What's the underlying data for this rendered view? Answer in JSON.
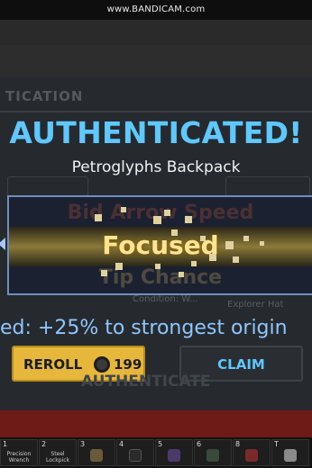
{
  "watermark": "www.BANDICAM.com",
  "background": {
    "ghost_title": "TICATION",
    "ghost_item_label": "Explorer Hat",
    "ghost_condition_label": "Condition: W...",
    "ghost_button": "AUTHENTICATE"
  },
  "popup": {
    "title": "AUTHENTICATED!",
    "item_name": "Petroglyphs Backpack",
    "options": {
      "previous": "Bid Arrow Speed",
      "selected": "Focused",
      "next": "Tip Chance"
    },
    "result_text": "ed: +25% to strongest origin",
    "reroll_label": "REROLL",
    "reroll_cost": "199",
    "claim_label": "CLAIM",
    "colors": {
      "title": "#5ec8ff",
      "selected": "#ffe493",
      "reroll_button": "#e6b73a",
      "claim_text": "#5ec8ff",
      "frame": "#6d8fbf"
    }
  },
  "hotbar": {
    "slots": [
      {
        "number": "1",
        "label": "Precision Wrench"
      },
      {
        "number": "2",
        "label": "Steel Lockpick"
      },
      {
        "number": "3",
        "label": ""
      },
      {
        "number": "4",
        "label": ""
      },
      {
        "number": "5",
        "label": ""
      },
      {
        "number": "6",
        "label": ""
      },
      {
        "number": "8",
        "label": ""
      },
      {
        "number": "T",
        "label": ""
      }
    ]
  }
}
